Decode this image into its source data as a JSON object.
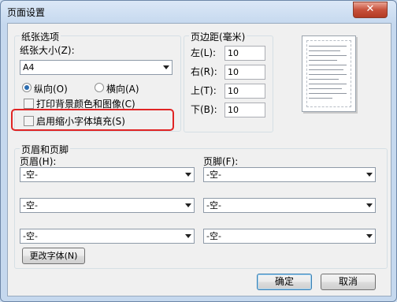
{
  "window": {
    "title": "页面设置",
    "close_glyph": "✕"
  },
  "paper": {
    "group_label": "纸张选项",
    "size_label": "纸张大小(Z):",
    "size_value": "A4",
    "portrait_label": "纵向(O)",
    "landscape_label": "横向(A)",
    "orientation_selected": "portrait",
    "print_bg_label": "打印背景颜色和图像(C)",
    "shrink_to_fit_label": "启用缩小字体填充(S)",
    "print_bg_checked": false,
    "shrink_to_fit_checked": false
  },
  "margins": {
    "group_label": "页边距(毫米)",
    "left_label": "左(L):",
    "left_value": "10",
    "right_label": "右(R):",
    "right_value": "10",
    "top_label": "上(T):",
    "top_value": "10",
    "bottom_label": "下(B):",
    "bottom_value": "10"
  },
  "header_footer": {
    "group_label": "页眉和页脚",
    "header_label": "页眉(H):",
    "footer_label": "页脚(F):",
    "header_rows": [
      "-空-",
      "-空-",
      "-空-"
    ],
    "footer_rows": [
      "-空-",
      "-空-",
      "-空-"
    ],
    "change_font_label": "更改字体(N)"
  },
  "buttons": {
    "ok_label": "确定",
    "cancel_label": "取消"
  },
  "colors": {
    "highlight": "#e02424",
    "title_bar": "#c5d8ee"
  }
}
